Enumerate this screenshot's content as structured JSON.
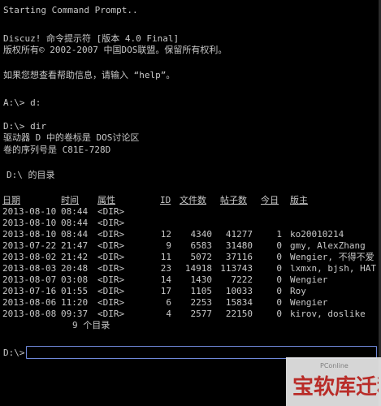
{
  "terminal": {
    "intro_line": "Starting Command Prompt..",
    "version_line": "Discuz! 命令提示符 [版本 4.0 Final]",
    "copyright_line": "版权所有© 2002-2007 中国DOS联盟。保留所有权利。",
    "help_line": "如果您想查看帮助信息，请输入 “help”。",
    "cmd1": "A:\\> d:",
    "cmd2": "D:\\> dir",
    "volume_label_line": "驱动器 D 中的卷标是 DOS讨论区",
    "serial_line": "卷的序列号是 C81E-728D",
    "dir_of_line": "D:\\ 的目录"
  },
  "table": {
    "headers": [
      "日期",
      "时间",
      "属性",
      "ID",
      "文件数",
      "帖子数",
      "今日",
      "版主"
    ],
    "rows": [
      {
        "date": "2013-08-10",
        "time": "08:44",
        "attr": "<DIR>",
        "id": "",
        "files": "",
        "posts": "",
        "today": "",
        "mods": ""
      },
      {
        "date": "2013-08-10",
        "time": "08:44",
        "attr": "<DIR>",
        "id": "",
        "files": "",
        "posts": "",
        "today": "",
        "mods": ""
      },
      {
        "date": "2013-08-10",
        "time": "08:44",
        "attr": "<DIR>",
        "id": "12",
        "files": "4340",
        "posts": "41277",
        "today": "1",
        "mods": "ko20010214"
      },
      {
        "date": "2013-07-22",
        "time": "21:47",
        "attr": "<DIR>",
        "id": "9",
        "files": "6583",
        "posts": "31480",
        "today": "0",
        "mods": "gmy, AlexZhang"
      },
      {
        "date": "2013-08-02",
        "time": "21:42",
        "attr": "<DIR>",
        "id": "11",
        "files": "5072",
        "posts": "37116",
        "today": "0",
        "mods": "Wengier, 不得不爱"
      },
      {
        "date": "2013-08-03",
        "time": "20:48",
        "attr": "<DIR>",
        "id": "23",
        "files": "14918",
        "posts": "113743",
        "today": "0",
        "mods": "lxmxn, bjsh, HAT"
      },
      {
        "date": "2013-08-07",
        "time": "03:08",
        "attr": "<DIR>",
        "id": "14",
        "files": "1430",
        "posts": "7222",
        "today": "0",
        "mods": "Wengier"
      },
      {
        "date": "2013-07-16",
        "time": "01:55",
        "attr": "<DIR>",
        "id": "17",
        "files": "1105",
        "posts": "10033",
        "today": "0",
        "mods": "Roy"
      },
      {
        "date": "2013-08-06",
        "time": "11:20",
        "attr": "<DIR>",
        "id": "6",
        "files": "2253",
        "posts": "15834",
        "today": "0",
        "mods": "Wengier"
      },
      {
        "date": "2013-08-08",
        "time": "09:37",
        "attr": "<DIR>",
        "id": "4",
        "files": "2577",
        "posts": "22150",
        "today": "0",
        "mods": "kirov, doslike"
      }
    ],
    "summary": "9 个目录"
  },
  "prompt": {
    "label": "D:\\>",
    "value": ""
  },
  "watermark": {
    "small_text": "PConline",
    "logo_text": "宝软库迁移"
  },
  "colors": {
    "background": "#000000",
    "text": "#c8c8c8",
    "input_border": "#6f88d8",
    "watermark_red": "#c9302c"
  }
}
